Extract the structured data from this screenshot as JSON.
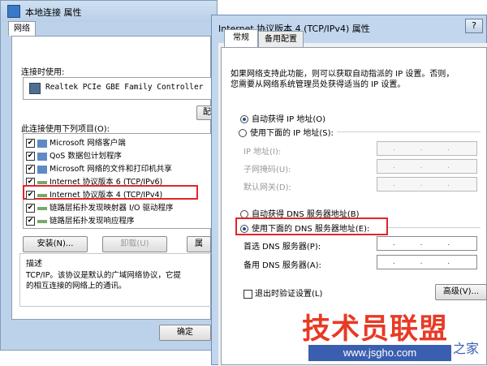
{
  "back_window": {
    "title": "本地连接 属性",
    "tab": "网络",
    "connect_using_label": "连接时使用:",
    "adapter": "Realtek PCIe GBE Family Controller",
    "configure_button": "配",
    "items_label": "此连接使用下列项目(O):",
    "items": [
      {
        "checked": true,
        "label": "Microsoft 网络客户端"
      },
      {
        "checked": true,
        "label": "QoS 数据包计划程序"
      },
      {
        "checked": true,
        "label": "Microsoft 网络的文件和打印机共享"
      },
      {
        "checked": true,
        "label": "Internet 协议版本 6 (TCP/IPv6)"
      },
      {
        "checked": true,
        "label": "Internet 协议版本 4 (TCP/IPv4)"
      },
      {
        "checked": true,
        "label": "链路层拓扑发现映射器 I/O 驱动程序"
      },
      {
        "checked": true,
        "label": "链路层拓扑发现响应程序"
      }
    ],
    "install_button": "安装(N)...",
    "uninstall_button": "卸载(U)",
    "properties_button": "属",
    "desc_title": "描述",
    "desc_text_1": "TCP/IP。该协议是默认的广域网络协议，它提",
    "desc_text_2": "的相互连接的网络上的通讯。",
    "ok_button": "确定"
  },
  "front_window": {
    "title": "Internet 协议版本 4 (TCP/IPv4) 属性",
    "help_button": "?",
    "tabs": [
      "常规",
      "备用配置"
    ],
    "intro_1": "如果网络支持此功能，则可以获取自动指派的 IP 设置。否则，",
    "intro_2": "您需要从网络系统管理员处获得适当的 IP 设置。",
    "auto_ip": "自动获得 IP 地址(O)",
    "manual_ip": "使用下面的 IP 地址(S):",
    "ip_address": "IP 地址(I):",
    "subnet_mask": "子网掩码(U):",
    "gateway": "默认网关(D):",
    "auto_dns": "自动获得 DNS 服务器地址(B)",
    "manual_dns": "使用下面的 DNS 服务器地址(E):",
    "preferred_dns": "首选 DNS 服务器(P):",
    "alternate_dns": "备用 DNS 服务器(A):",
    "ip_placeholder": ". . .",
    "validate_on_exit": "退出时验证设置(L)",
    "advanced_button": "高级(V)..."
  },
  "watermark": {
    "brand": "技术员联盟",
    "url": "www.jsgho.com",
    "tail": "之家"
  },
  "colors": {
    "highlight": "#e0262b",
    "watermark_red": "#e83a24",
    "watermark_blue": "#3b5fb0"
  }
}
